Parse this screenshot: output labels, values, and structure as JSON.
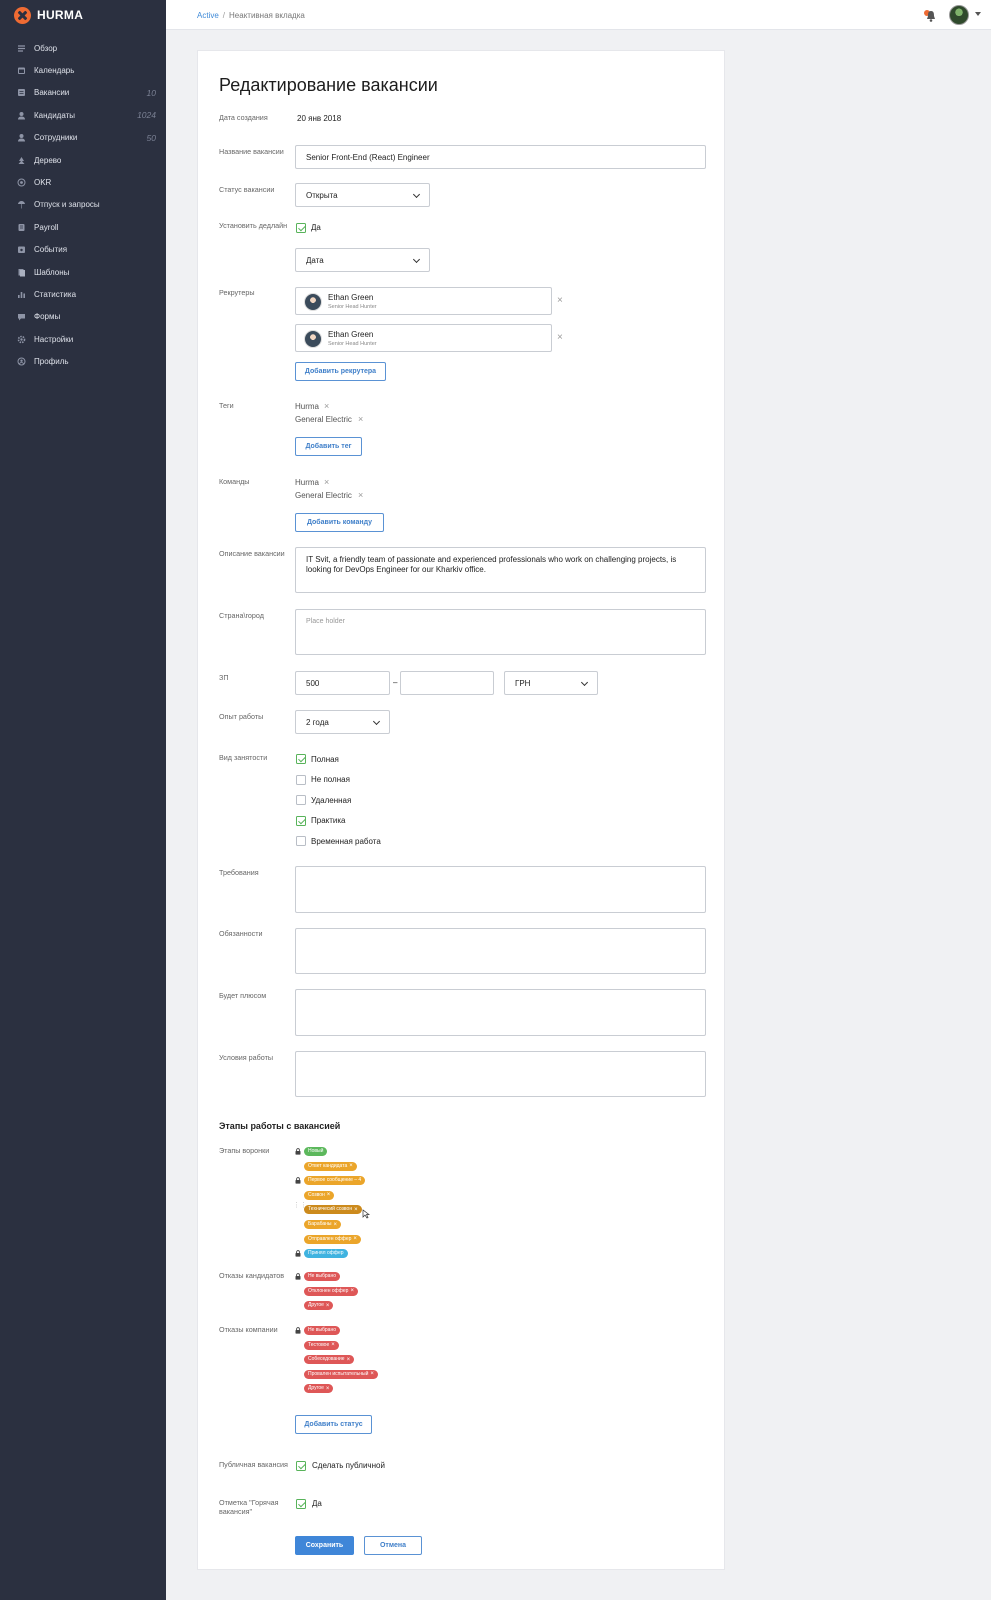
{
  "app": {
    "logo": "HURMA"
  },
  "sidebar": {
    "items": [
      {
        "label": "Обзор",
        "icon": "overview-icon",
        "count": ""
      },
      {
        "label": "Календарь",
        "icon": "calendar-icon",
        "count": ""
      },
      {
        "label": "Вакансии",
        "icon": "vacancies-icon",
        "count": "10"
      },
      {
        "label": "Кандидаты",
        "icon": "candidates-icon",
        "count": "1024"
      },
      {
        "label": "Сотрудники",
        "icon": "employees-icon",
        "count": "50"
      },
      {
        "label": "Дерево",
        "icon": "tree-icon",
        "count": ""
      },
      {
        "label": "OKR",
        "icon": "okr-icon",
        "count": ""
      },
      {
        "label": "Отпуск и запросы",
        "icon": "vacation-icon",
        "count": ""
      },
      {
        "label": "Payroll",
        "icon": "payroll-icon",
        "count": ""
      },
      {
        "label": "События",
        "icon": "events-icon",
        "count": ""
      },
      {
        "label": "Шаблоны",
        "icon": "templates-icon",
        "count": ""
      },
      {
        "label": "Статистика",
        "icon": "statistics-icon",
        "count": ""
      },
      {
        "label": "Формы",
        "icon": "forms-icon",
        "count": ""
      },
      {
        "label": "Настройки",
        "icon": "gear-icon",
        "count": ""
      },
      {
        "label": "Профиль",
        "icon": "profile-icon",
        "count": ""
      }
    ]
  },
  "topbar": {
    "breadcrumb_active": "Active",
    "breadcrumb_separator": "/",
    "breadcrumb_current": "Неактивная вкладка"
  },
  "form": {
    "title": "Редактирование вакансии",
    "created_label": "Дата создания",
    "created_value": "20 янв 2018",
    "name_label": "Название вакансии",
    "name_value": "Senior Front-End (React) Engineer",
    "status_label": "Статус вакансии",
    "status_value": "Открыта",
    "deadline_label": "Установить дедлайн",
    "deadline_checkbox": "Да",
    "deadline_select": "Дата",
    "recruiters_label": "Рекрутеры",
    "recruiters": [
      {
        "name": "Ethan Green",
        "role": "Senior Head Hunter"
      },
      {
        "name": "Ethan Green",
        "role": "Senior Head Hunter"
      }
    ],
    "add_recruiter": "Добавить рекрутера",
    "tags_label": "Теги",
    "tags": [
      "Hurma",
      "General Electric"
    ],
    "add_tag": "Добавить тег",
    "teams_label": "Команды",
    "teams": [
      "Hurma",
      "General Electric"
    ],
    "add_team": "Добавить команду",
    "description_label": "Описание вакансии",
    "description_value": "IT Svit, a friendly team of passionate and experienced professionals who work on challenging projects, is looking for DevOps Engineer for our Kharkiv office.",
    "location_label": "Страна\\город",
    "location_placeholder": "Place holder",
    "salary_label": "ЗП",
    "salary_from": "500",
    "salary_dash": "–",
    "salary_to": "",
    "currency": "ГРН",
    "experience_label": "Опыт работы",
    "experience_value": "2 года",
    "employment_label": "Вид занятости",
    "employment_options": [
      {
        "label": "Полная",
        "checked": true
      },
      {
        "label": "Не полная",
        "checked": false
      },
      {
        "label": "Удаленная",
        "checked": false
      },
      {
        "label": "Практика",
        "checked": true
      },
      {
        "label": "Временная работа",
        "checked": false
      }
    ],
    "requirements_label": "Требования",
    "duties_label": "Обязанности",
    "plus_label": "Будет плюсом",
    "conditions_label": "Условия работы",
    "stages_title": "Этапы работы с вакансией",
    "funnel_label": "Этапы воронки",
    "funnel": [
      {
        "label": "Новый",
        "color": "#5cb85c",
        "locked": true,
        "removable": false
      },
      {
        "label": "Ответ кандидата",
        "color": "#eba52a",
        "locked": false,
        "removable": true
      },
      {
        "label": "Первое сообщение – 4",
        "color": "#eba52a",
        "locked": true,
        "removable": false
      },
      {
        "label": "Созвон",
        "color": "#eba52a",
        "locked": false,
        "removable": true
      },
      {
        "label": "Техничесий созвон",
        "color": "#cc8a1c",
        "locked": false,
        "removable": true
      },
      {
        "label": "Барабаны",
        "color": "#eba52a",
        "locked": false,
        "removable": true
      },
      {
        "label": "Отправлен оффер",
        "color": "#eba52a",
        "locked": false,
        "removable": true
      },
      {
        "label": "Принял оффер",
        "color": "#3fb3e0",
        "locked": true,
        "removable": false
      }
    ],
    "candidate_refusals_label": "Отказы кандидатов",
    "candidate_refusals": [
      {
        "label": "Не выбрано",
        "locked": true,
        "removable": false
      },
      {
        "label": "Отклонен оффер",
        "locked": false,
        "removable": true
      },
      {
        "label": "Другое",
        "locked": false,
        "removable": true
      }
    ],
    "company_refusals_label": "Отказы компании",
    "company_refusals": [
      {
        "label": "Не выбрано",
        "locked": true,
        "removable": false
      },
      {
        "label": "Тестовое",
        "locked": false,
        "removable": true
      },
      {
        "label": "Собеседование",
        "locked": false,
        "removable": true
      },
      {
        "label": "Провален испытательный",
        "locked": false,
        "removable": true
      },
      {
        "label": "Другое",
        "locked": false,
        "removable": true
      }
    ],
    "add_status": "Добавить статус",
    "public_label": "Публичная вакансия",
    "public_checkbox": "Сделать публичной",
    "hot_label": "Отметка \"Горячая вакансия\"",
    "hot_checkbox": "Да",
    "save": "Сохранить",
    "cancel": "Отмена"
  },
  "colors": {
    "sidebar": "#2b3040",
    "accent": "#3f86d8",
    "brand": "#ef6b33"
  }
}
